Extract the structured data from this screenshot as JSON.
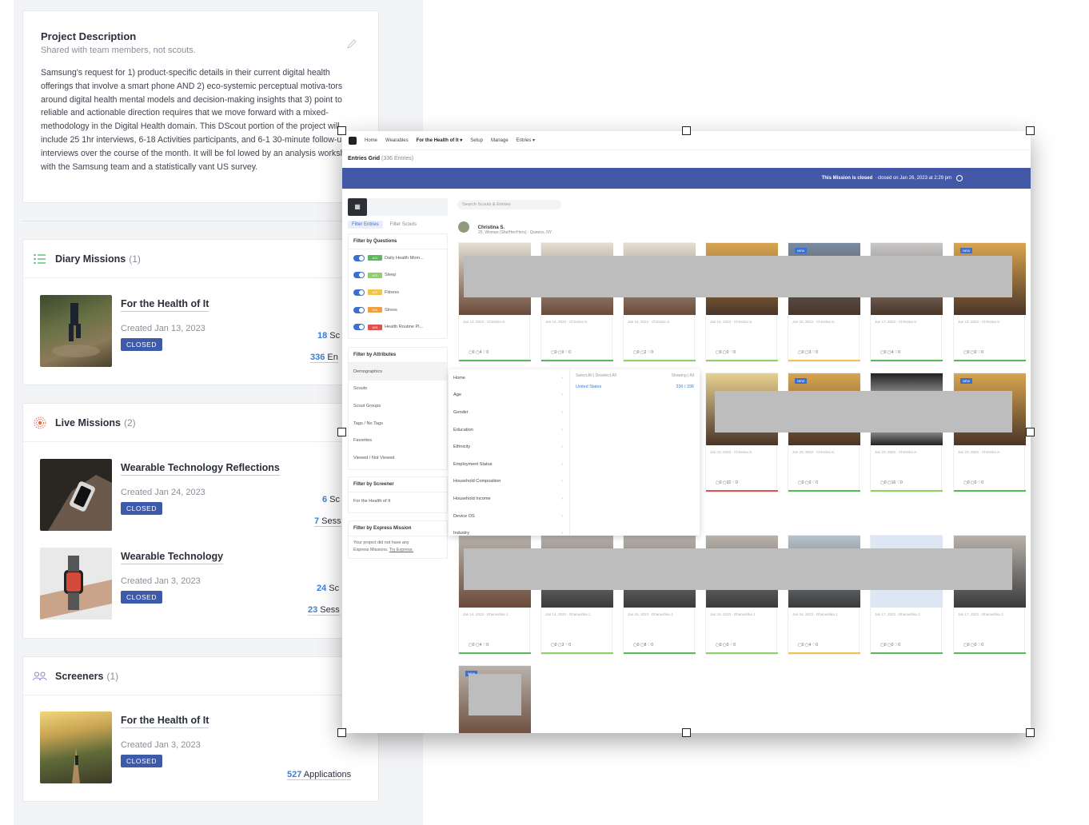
{
  "project": {
    "title": "Project Description",
    "subtitle": "Shared with team members, not scouts.",
    "body": "Samsung's request for 1) product-specific details in their current digital health offerings that involve a smart phone AND 2) eco-systemic perceptual motiva-tors around digital health mental models and decision-making insights that 3) point to reliable and actionable direction requires that we move forward with a mixed-methodology in the Digital Health domain. This DScout portion of the project will include 25 1hr interviews, 6-18 Activities participants, and 6-1 30-minute follow-up interviews over the course of the month. It will be fol lowed by an analysis workshop with the Samsung team and a statistically vant US survey."
  },
  "diary": {
    "title": "Diary Missions",
    "count": "(1)",
    "missions": [
      {
        "title": "For the Health of It",
        "date": "Created Jan 13, 2023",
        "badge": "CLOSED",
        "stat1_num": "18",
        "stat1_txt": " Sc",
        "stat2_num": "336",
        "stat2_txt": " En"
      }
    ]
  },
  "live": {
    "title": "Live Missions",
    "count": "(2)",
    "missions": [
      {
        "title": "Wearable Technology Reflections",
        "date": "Created Jan 24, 2023",
        "badge": "CLOSED",
        "stat1_num": "6",
        "stat1_txt": " Sc",
        "stat2_num": "7",
        "stat2_txt": " Sess"
      },
      {
        "title": "Wearable Technology",
        "date": "Created Jan 3, 2023",
        "badge": "CLOSED",
        "stat1_num": "24",
        "stat1_txt": " Sc",
        "stat2_num": "23",
        "stat2_txt": " Sess"
      }
    ]
  },
  "screeners": {
    "title": "Screeners",
    "count": "(1)",
    "missions": [
      {
        "title": "For the Health of It",
        "date": "Created Jan 3, 2023",
        "badge": "CLOSED",
        "stat_num": "527",
        "stat_txt": " Applications"
      }
    ]
  },
  "shot": {
    "nav": [
      "Home",
      "Wearables",
      "For the Health of It ▾",
      "Setup",
      "Manage",
      "Entries ▾"
    ],
    "entries_title": "Entries Grid",
    "entries_count": "(336 Entries)",
    "banner_bold": "This Mission is closed",
    "banner_rest": "· closed on Jan 26, 2023 at 2:29 pm",
    "search_placeholder": "Search Scouts & Entries",
    "tab_entries": "Filter Entries",
    "tab_scouts": "Filter Scouts",
    "filter_questions": "Filter by Questions",
    "questions": [
      {
        "tag": "#11",
        "label": "Daily Health Mom...",
        "color": "#5cb85c"
      },
      {
        "tag": "#12",
        "label": "Sleep",
        "color": "#8fcf6a"
      },
      {
        "tag": "#13",
        "label": "Fitness",
        "color": "#f0c34a"
      },
      {
        "tag": "#14",
        "label": "Stress",
        "color": "#f0a040"
      },
      {
        "tag": "#15",
        "label": "Health Routine Pl...",
        "color": "#e05050"
      }
    ],
    "filter_attributes": "Filter by Attributes",
    "attributes": [
      "Demographics",
      "Scouts",
      "Scout Groups",
      "Tags / No Tags",
      "Favorites",
      "Viewed / Not Viewed"
    ],
    "filter_screener": "Filter by Screener",
    "screener_item": "For the Health of It",
    "filter_express": "Filter by Express Mission",
    "express_note_1": "Your project did not have any",
    "express_note_2": "Express Missions.",
    "express_link": "Try Express.",
    "menu_items": [
      "Home",
      "Age",
      "Gender",
      "Education",
      "Ethnicity",
      "Employment Status",
      "Household Composition",
      "Household Income",
      "Device OS",
      "Industry"
    ],
    "menu_select": "Select All | Deselect All",
    "menu_showing": "Showing | All",
    "menu_country": "United States",
    "menu_country_count": "336 / 336",
    "user_name": "Christina S.",
    "user_meta": "25, Woman (She/Her/Hers) · Queens, NY",
    "row1_caps": [
      "Jan 14, 2023 · Christina S.",
      "Jan 14, 2023 · Christina S.",
      "Jan 15, 2023 · Christina S.",
      "Jan 15, 2023 · Christina S.",
      "Jan 16, 2023 · Christina S.",
      "Jan 17, 2023 · Christina S.",
      "Jan 18, 2023 · Christina S."
    ],
    "row1_counts": [
      "▢0  ▢4  ♡0",
      "▢0  ▢0  ♡0",
      "▢0  ▢2  ♡0",
      "▢0  ▢0  ♡0",
      "▢0  ▢3  ♡0",
      "▢0  ▢4  ♡0",
      "▢0  ▢0  ♡0"
    ],
    "row2_caps": [
      "Jan 22, 2023 · Christina S.",
      "Jan 23, 2023 · Christina S.",
      "Jan 23, 2023 · Christina S.",
      "Jan 23, 2023 · Christina S."
    ],
    "row2_counts": [
      "▢0  ▢32  ♡0",
      "▢0  ▢0  ♡0",
      "▢0  ▢16  ♡0",
      "▢0  ▢0  ♡0"
    ],
    "row3_caps": [
      "Jan 14, 2023 · Dhanushka J.",
      "Jan 14, 2023 · Dhanushka J.",
      "Jan 15, 2023 · Dhanushka J.",
      "Jan 15, 2023 · Dhanushka J.",
      "Jan 16, 2023 · Dhanushka J.",
      "Jan 17, 2023 · Dhanushka J.",
      "Jan 17, 2023 · Dhanushka J."
    ],
    "row3_counts": [
      "▢0  ▢4  ♡0",
      "▢0  ▢3  ♡0",
      "▢0  ▢8  ♡0",
      "▢0  ▢0  ♡0",
      "▢0  ▢4  ♡0",
      "▢0  ▢0  ♡0",
      "▢0  ▢0  ♡0"
    ],
    "new_badge": "NEW"
  }
}
